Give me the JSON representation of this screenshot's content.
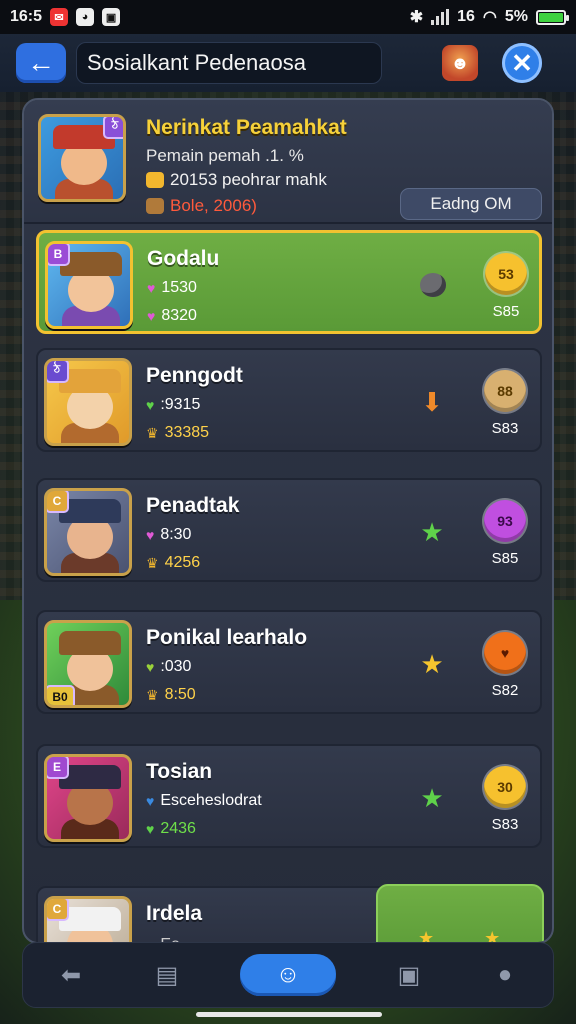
{
  "status_bar": {
    "time": "16:5",
    "signal_text": "16",
    "battery": "5%"
  },
  "header": {
    "title": "Sosialkant Pedenaosa"
  },
  "profile": {
    "name": "Nerinkat Peamahkat",
    "subtitle": "Pemain pemah .1. %",
    "stat1": "20153 peohrar mahk",
    "stat2": "Bole, 2006)",
    "status": "Eadng OM",
    "badge": "ঠ"
  },
  "players": [
    {
      "name": "Godalu",
      "stat1": "1530",
      "stat2": "8320",
      "price": "S85",
      "coin_label": "53",
      "badge": "B",
      "selected": true,
      "coin_color": "#f6c12e",
      "accent": "#9a4cd6",
      "mid_icon": "pebble-icon"
    },
    {
      "name": "Penngodt",
      "stat1": ":9315",
      "stat2": "33385",
      "price": "S83",
      "coin_label": "88",
      "badge": "ঠ",
      "selected": false,
      "coin_color": "#d8b070",
      "accent": "#f0c24a",
      "mid_icon": "orange-arrow-icon"
    },
    {
      "name": "Penadtak",
      "stat1": "8:30",
      "stat2": "4256",
      "price": "S85",
      "coin_label": "93",
      "badge": "C",
      "selected": false,
      "coin_color": "#c04fe0",
      "accent": "#7a86a8",
      "mid_icon": "green-star-icon"
    },
    {
      "name": "Ponikal learhalo",
      "stat1": ":030",
      "stat2": "8:50",
      "price": "S82",
      "coin_label": "♥",
      "badge": "B0",
      "selected": false,
      "coin_color": "#f0701a",
      "accent": "#59b64a",
      "mid_icon": "yellow-star-icon"
    },
    {
      "name": "Tosian",
      "stat1": "Esceheslodrat",
      "stat2": "2436",
      "price": "S83",
      "coin_label": "30",
      "badge": "E",
      "selected": false,
      "coin_color": "#f6c12e",
      "accent": "#e0458a",
      "mid_icon": "green-star-icon"
    }
  ],
  "bottom_player": {
    "name": "Irdela",
    "stat1": "Eo ...",
    "badge": "C"
  },
  "nav": {
    "items": [
      "back",
      "chat",
      "friends",
      "cards",
      "profile"
    ]
  }
}
